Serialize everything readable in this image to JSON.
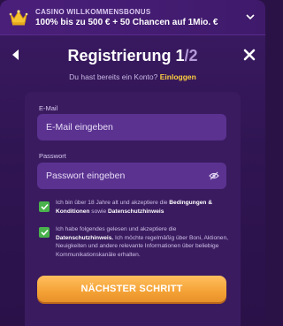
{
  "banner": {
    "label": "CASINO WILLKOMMENSBONUS",
    "offer": "100% bis zu 500 € + 50 Chancen auf 1Mio. €",
    "icon": "crown-icon",
    "expand_icon": "chevron-down-icon"
  },
  "header": {
    "title": "Registrierung 1",
    "step_total": "/2",
    "login_prompt": "Du hast bereits ein Konto?",
    "login_link": "Einloggen"
  },
  "form": {
    "email": {
      "label": "E-Mail",
      "placeholder": "E-Mail eingeben",
      "value": ""
    },
    "password": {
      "label": "Passwort",
      "placeholder": "Passwort eingeben",
      "value": ""
    },
    "consent_terms": {
      "checked": true,
      "text_before": "Ich bin über 18 Jahre alt und akzeptiere die ",
      "link_terms": "Bedingungen & Konditionen",
      "text_middle": " sowie ",
      "link_privacy": "Datenschutzhinweis"
    },
    "consent_marketing": {
      "checked": true,
      "text_before": "Ich habe folgendes gelesen und akzeptiere die ",
      "link_privacy": "Datenschutzhinweis.",
      "text_after": " Ich möchte regelmäßig über Boni, Aktionen, Neuigkeiten und andere relevante Informationen über beliebige Kommunikationskanäle erhalten."
    },
    "submit_label": "NÄCHSTER SCHRITT"
  },
  "colors": {
    "background": "#2a1247",
    "card": "#3a1b60",
    "input": "#5b3290",
    "accent_link": "#ffcf3f",
    "checkbox": "#49b24c",
    "cta": "#f4a236"
  }
}
